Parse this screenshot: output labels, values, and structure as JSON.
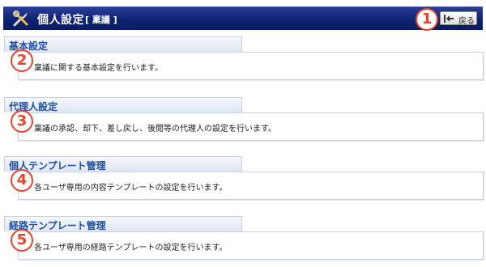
{
  "header": {
    "title": "個人設定",
    "subtitle": "[ 稟議 ]",
    "icon": "tools-icon"
  },
  "back_button": {
    "label": "戻る",
    "icon": "back-icon"
  },
  "markers": [
    "1",
    "2",
    "3",
    "4",
    "5"
  ],
  "sections": [
    {
      "title": "基本設定",
      "description": "稟議に関する基本設定を行います。"
    },
    {
      "title": "代理人設定",
      "description": "稟議の承認、却下、差し戻し、後閲等の代理人の設定を行います。"
    },
    {
      "title": "個人テンプレート管理",
      "description": "各ユーザ専用の内容テンプレートの設定を行います。"
    },
    {
      "title": "経路テンプレート管理",
      "description": "各ユーザ専用の経路テンプレートの設定を行います。"
    }
  ],
  "colors": {
    "header": "#0f2372",
    "link": "#1f4fa6",
    "marker": "#e8432f"
  }
}
